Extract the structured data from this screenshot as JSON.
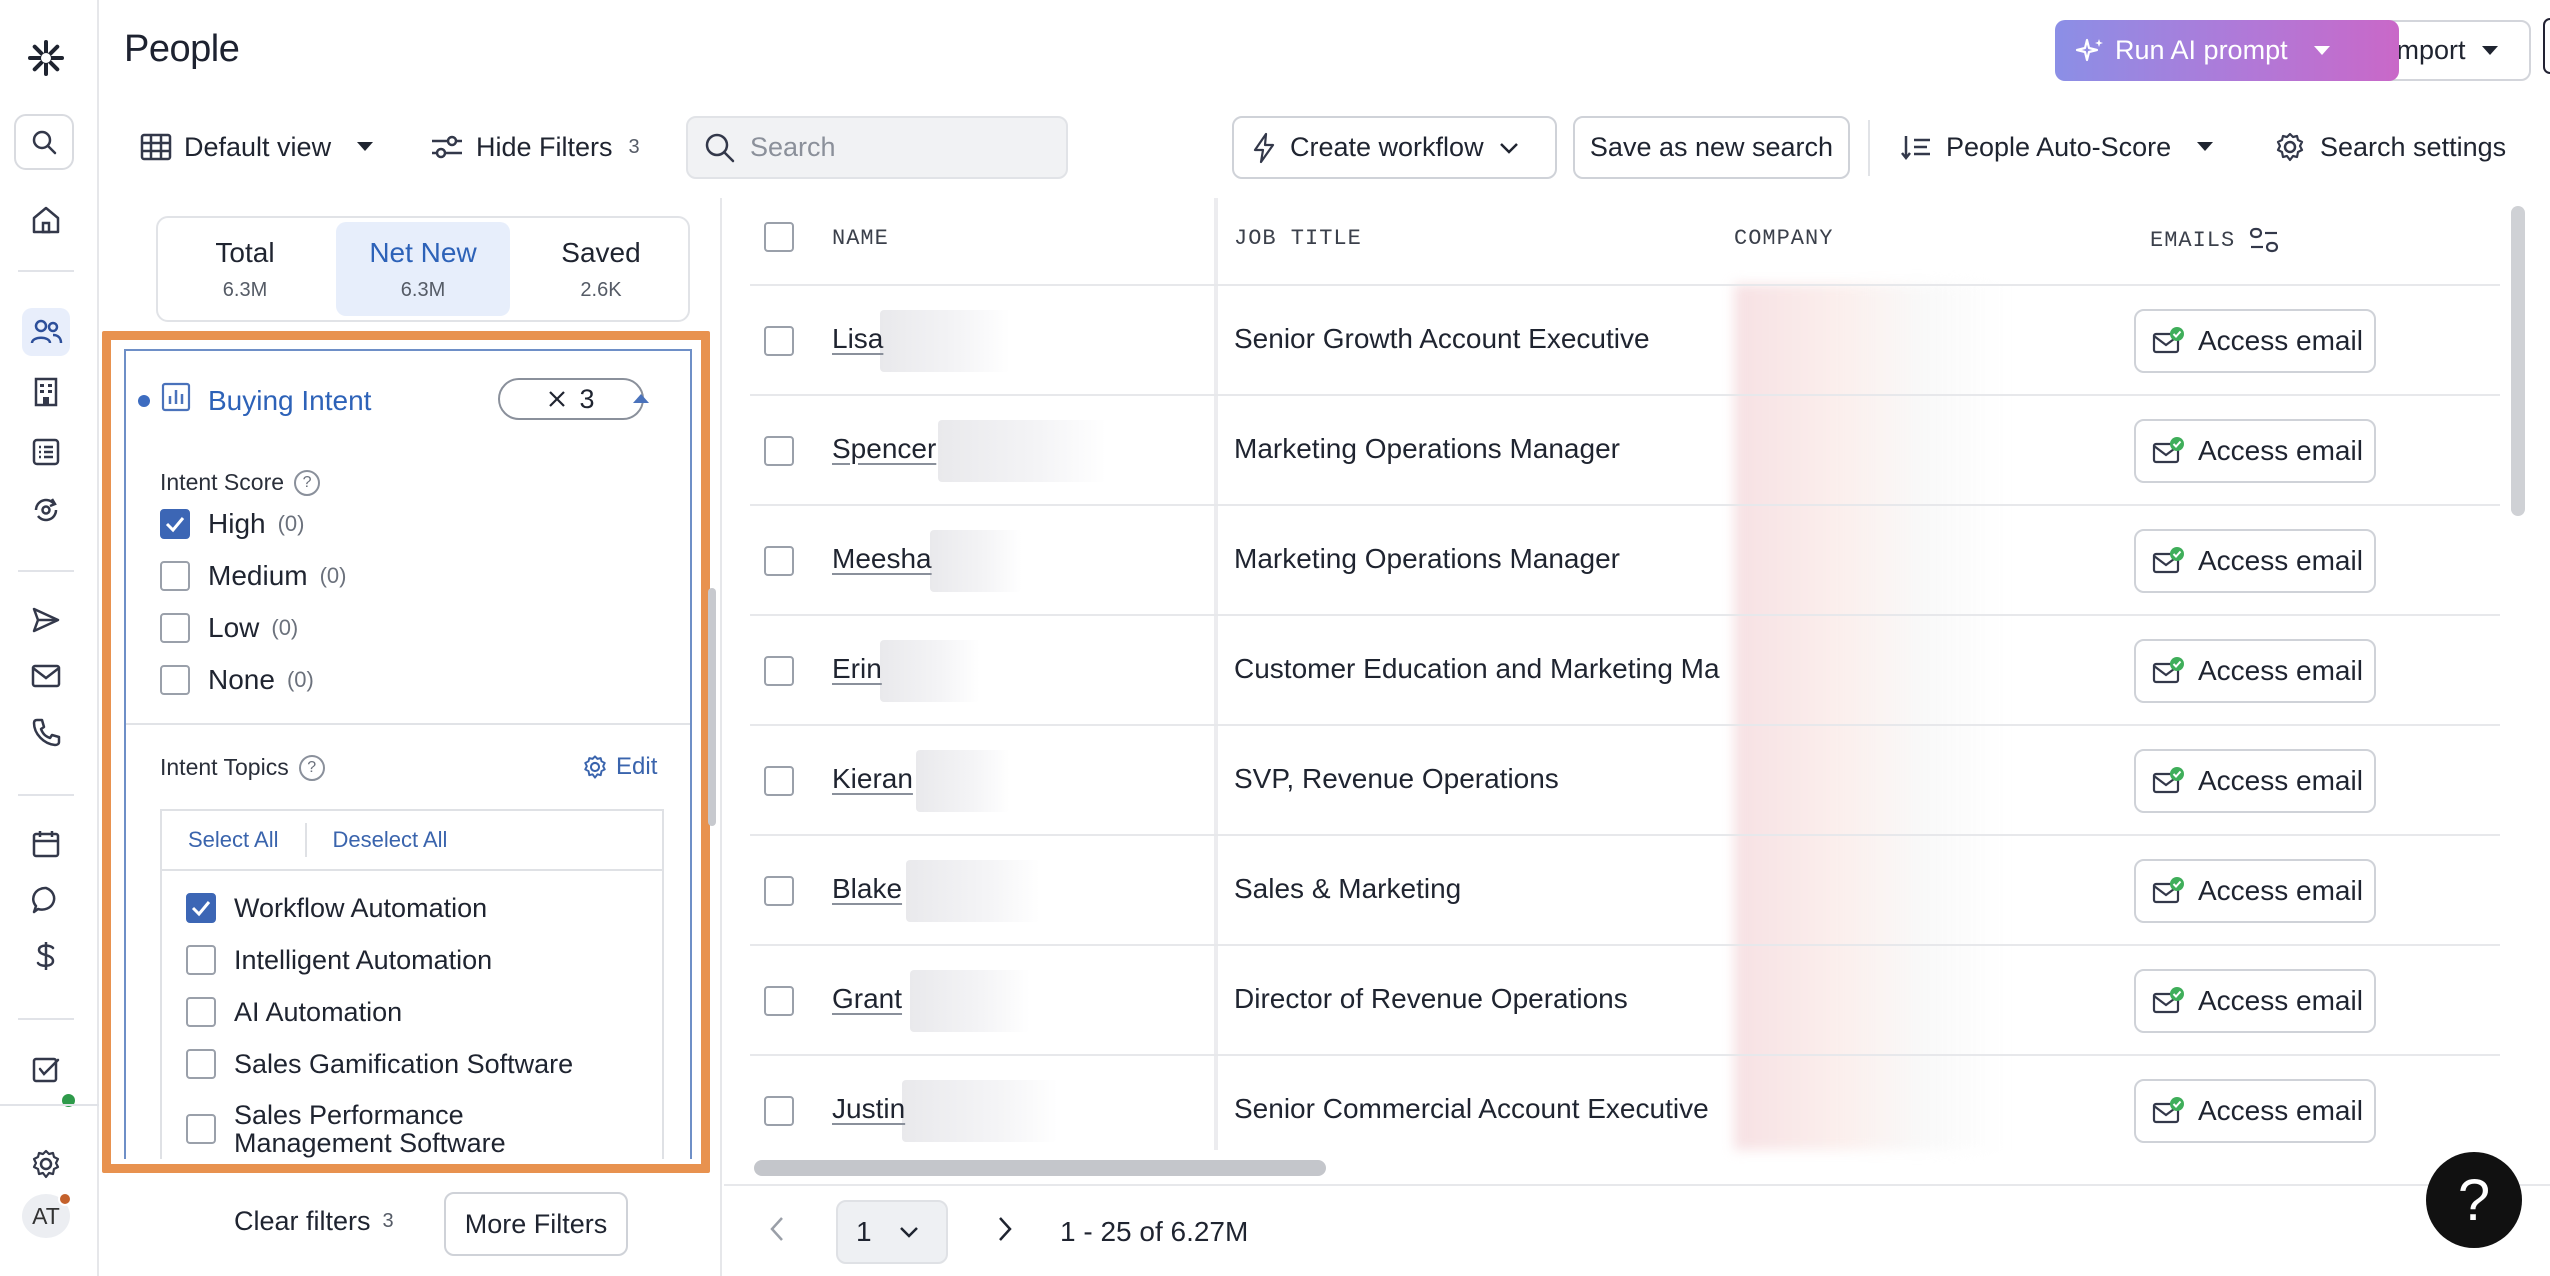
{
  "header": {
    "title": "People",
    "run_ai_label": "Run AI prompt",
    "import_label": "Import"
  },
  "toolbar": {
    "default_view_label": "Default view",
    "hide_filters_label": "Hide Filters",
    "hide_filters_count": "3",
    "search_placeholder": "Search",
    "create_workflow_label": "Create workflow",
    "save_search_label": "Save as new search",
    "auto_score_label": "People Auto-Score",
    "search_settings_label": "Search settings"
  },
  "sidebar": {
    "avatar_initials": "AT",
    "icons": [
      "logo-icon",
      "search-icon",
      "home-icon",
      "people-icon",
      "companies-icon",
      "lists-icon",
      "refresh-icon",
      "send-icon",
      "email-icon",
      "phone-icon",
      "calendar-icon",
      "chat-icon",
      "dollar-icon",
      "tasks-icon",
      "settings-icon"
    ]
  },
  "segments": [
    {
      "label": "Total",
      "count": "6.3M"
    },
    {
      "label": "Net New",
      "count": "6.3M"
    },
    {
      "label": "Saved",
      "count": "2.6K"
    }
  ],
  "buying_intent": {
    "title": "Buying Intent",
    "chip_count": "3",
    "intent_score_label": "Intent Score",
    "scores": [
      {
        "label": "High",
        "count": "(0)",
        "checked": true
      },
      {
        "label": "Medium",
        "count": "(0)",
        "checked": false
      },
      {
        "label": "Low",
        "count": "(0)",
        "checked": false
      },
      {
        "label": "None",
        "count": "(0)",
        "checked": false
      }
    ],
    "intent_topics_label": "Intent Topics",
    "edit_label": "Edit",
    "select_all_label": "Select All",
    "deselect_all_label": "Deselect All",
    "topics": [
      {
        "label": "Workflow Automation",
        "checked": true
      },
      {
        "label": "Intelligent Automation",
        "checked": false
      },
      {
        "label": "AI Automation",
        "checked": false
      },
      {
        "label": "Sales Gamification Software",
        "checked": false
      },
      {
        "label": "Sales Performance Management Software",
        "checked": false
      }
    ]
  },
  "filters_footer": {
    "clear_label": "Clear filters",
    "clear_count": "3",
    "more_label": "More Filters"
  },
  "table": {
    "columns": [
      "NAME",
      "JOB TITLE",
      "COMPANY",
      "EMAILS"
    ],
    "email_button_label": "Access email",
    "rows": [
      {
        "name": "Lisa",
        "job": "Senior Growth Account Executive"
      },
      {
        "name": "Spencer",
        "job": "Marketing Operations Manager"
      },
      {
        "name": "Meesha",
        "job": "Marketing Operations Manager"
      },
      {
        "name": "Erin",
        "job": "Customer Education and Marketing Ma"
      },
      {
        "name": "Kieran",
        "job": "SVP, Revenue Operations"
      },
      {
        "name": "Blake",
        "job": "Sales & Marketing"
      },
      {
        "name": "Grant",
        "job": "Director of Revenue Operations"
      },
      {
        "name": "Justin",
        "job": "Senior Commercial Account Executive"
      }
    ]
  },
  "pagination": {
    "page": "1",
    "range_text": "1 - 25 of 6.27M"
  },
  "colors": {
    "accent": "#2d62b8",
    "highlight_frame": "#e8924f",
    "ai_gradient_start": "#8b8fe6",
    "ai_gradient_end": "#c968c8"
  }
}
